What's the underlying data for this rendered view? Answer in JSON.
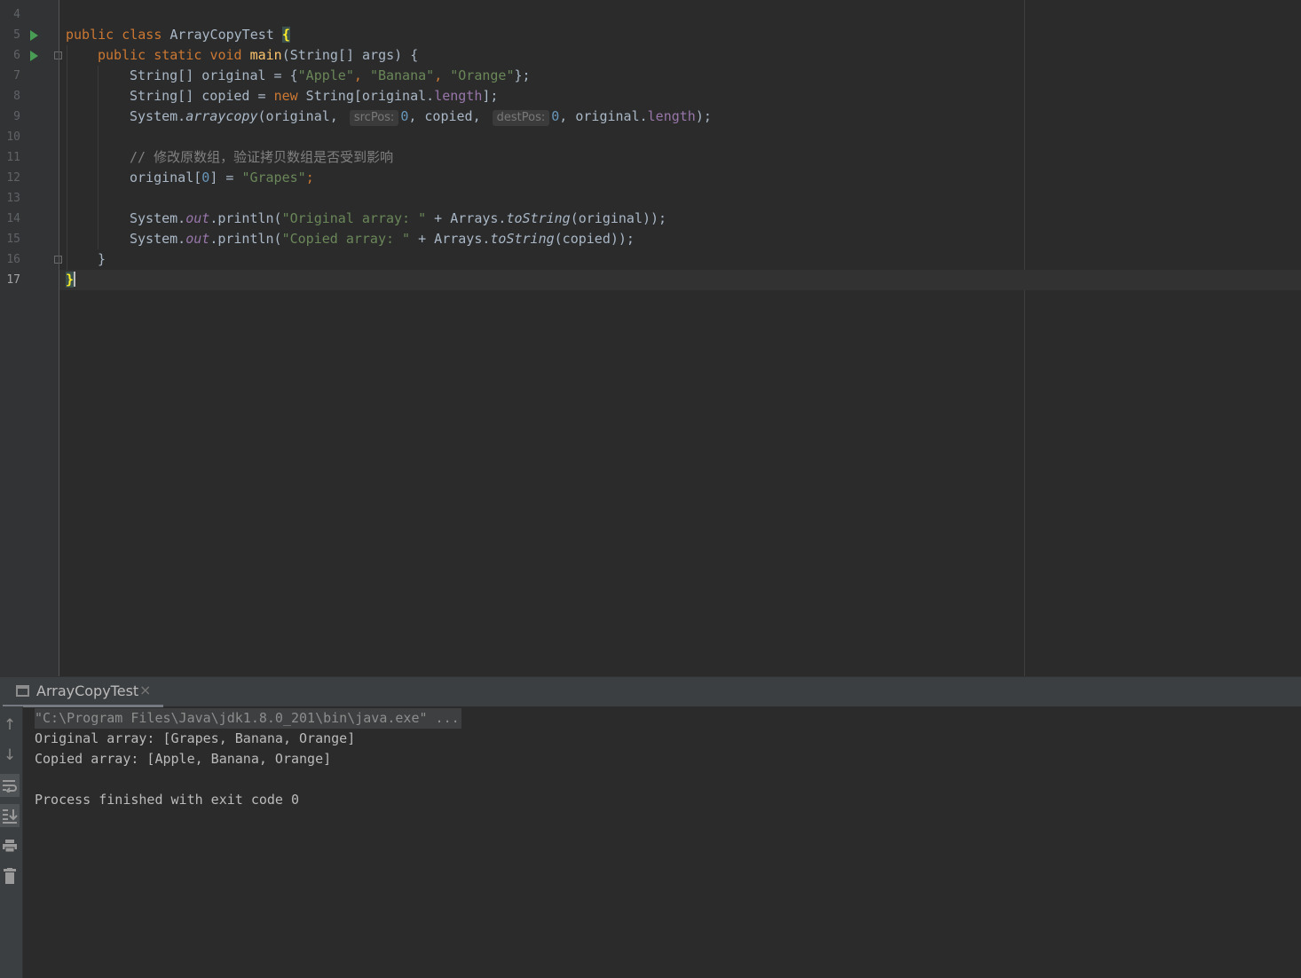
{
  "editor": {
    "line_numbers": [
      "4",
      "5",
      "6",
      "7",
      "8",
      "9",
      "10",
      "11",
      "12",
      "13",
      "14",
      "15",
      "16",
      "17"
    ],
    "current_line": "17",
    "code": {
      "l5": {
        "kw1": "public",
        "kw2": "class",
        "name": "ArrayCopyTest",
        "brace": "{"
      },
      "l6": {
        "kw1": "public",
        "kw2": "static",
        "kw3": "void",
        "method": "main",
        "rest": "(String[] args) {"
      },
      "l7": {
        "pre": "String[] original = {",
        "s1": "\"Apple\"",
        "c1": ", ",
        "s2": "\"Banana\"",
        "c2": ", ",
        "s3": "\"Orange\"",
        "end": "};"
      },
      "l8": {
        "pre": "String[] copied = ",
        "kw": "new",
        "mid": " String[original.",
        "field": "length",
        "end": "];"
      },
      "l9": {
        "pre": "System.",
        "method": "arraycopy",
        "a1": "(original, ",
        "hint1": "srcPos:",
        "n1": "0",
        "a2": ", copied, ",
        "hint2": "destPos:",
        "n2": "0",
        "a3": ", original.",
        "field": "length",
        "end": ");"
      },
      "l11": {
        "comment": "// 修改原数组，验证拷贝数组是否受到影响"
      },
      "l12": {
        "pre": "original[",
        "num": "0",
        "mid": "] = ",
        "str": "\"Grapes\"",
        "end": ";"
      },
      "l14": {
        "pre": "System.",
        "out": "out",
        "mid": ".println(",
        "str": "\"Original array: \"",
        "mid2": " + Arrays.",
        "method": "toString",
        "end": "(original));"
      },
      "l15": {
        "pre": "System.",
        "out": "out",
        "mid": ".println(",
        "str": "\"Copied array: \"",
        "mid2": " + Arrays.",
        "method": "toString",
        "end": "(copied));"
      },
      "l16": {
        "text": "}"
      },
      "l17": {
        "text": "}"
      }
    }
  },
  "run_panel": {
    "tab_title": "ArrayCopyTest",
    "close_glyph": "×",
    "console_lines": [
      "\"C:\\Program Files\\Java\\jdk1.8.0_201\\bin\\java.exe\" ...",
      "Original array: [Grapes, Banana, Orange]",
      "Copied array: [Apple, Banana, Orange]",
      "",
      "Process finished with exit code 0"
    ],
    "toolbar_icons": [
      "up-arrow-icon",
      "down-arrow-icon",
      "soft-wrap-icon",
      "scroll-to-end-icon",
      "print-icon",
      "trash-icon"
    ]
  },
  "colors": {
    "editor_bg": "#2b2b2b",
    "gutter_bg": "#313335",
    "keyword": "#cc7832",
    "string": "#6a8759",
    "number": "#6897bb",
    "field": "#9876aa",
    "method_decl": "#ffc66d",
    "comment": "#808080",
    "run_icon": "#499c54"
  }
}
